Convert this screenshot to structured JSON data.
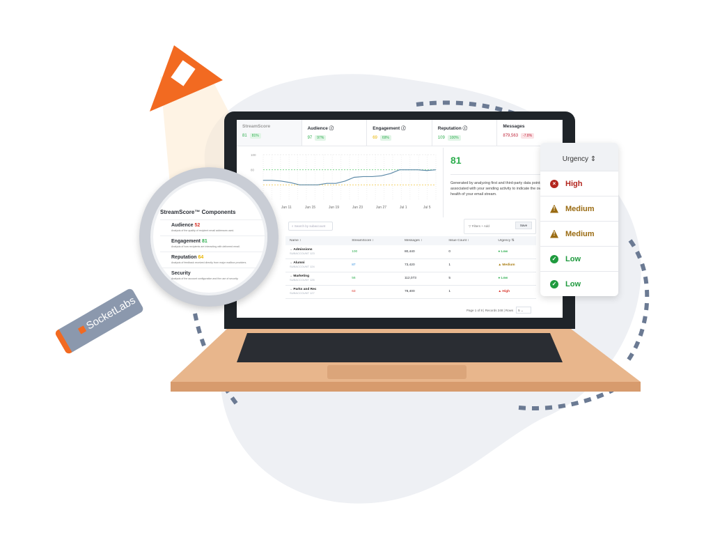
{
  "kpis": [
    {
      "label": "StreamScore",
      "value": "81",
      "pct": "81%"
    },
    {
      "label": "Audience ⓘ",
      "value": "97",
      "pct": "97%"
    },
    {
      "label": "Engagement ⓘ",
      "value": "69",
      "pct": "69%"
    },
    {
      "label": "Reputation ⓘ",
      "value": "109",
      "pct": "100%"
    },
    {
      "label": "Messages",
      "value": "879,563",
      "pct": "-7.8%"
    }
  ],
  "chart_data": {
    "type": "line",
    "x": [
      "Jun 11",
      "Jun 15",
      "Jun 19",
      "Jun 23",
      "Jun 27",
      "Jul 1",
      "Jul 5"
    ],
    "y_ticks": [
      "100",
      "80",
      "60"
    ],
    "ylim": [
      40,
      100
    ],
    "values": [
      66,
      66,
      65,
      63,
      60,
      60,
      60,
      62,
      62,
      65,
      70,
      71,
      71,
      72,
      75,
      80,
      80,
      80,
      79,
      80
    ],
    "thresholds": [
      80,
      60
    ]
  },
  "score": {
    "value": "81",
    "description": "Generated by analyzing first and third-party data points associated with your sending activity to indicate the overall health of your email stream."
  },
  "search": {
    "placeholder": "Search by subaccount"
  },
  "filters": {
    "label": "▽ Filters",
    "add": "+ Add",
    "save": "Save"
  },
  "table": {
    "headers": [
      "Name ↕",
      "StreamScore ↕",
      "Messages ↕",
      "Issue Count ↕",
      "Urgency ⇅"
    ],
    "rows": [
      {
        "name": "Admissions",
        "sub": "SUBACCOUNT 123",
        "score": "100",
        "sc": "g",
        "messages": "80,440",
        "issues": "0",
        "urgency": "● Low",
        "uc": "g"
      },
      {
        "name": "Alumni",
        "sub": "SUBACCOUNT 124",
        "score": "87",
        "sc": "b",
        "messages": "73,420",
        "issues": "1",
        "urgency": "▲ Medium",
        "uc": "m"
      },
      {
        "name": "Marketing",
        "sub": "SUBACCOUNT 126",
        "score": "56",
        "sc": "g",
        "messages": "112,073",
        "issues": "5",
        "urgency": "● Low",
        "uc": "g"
      },
      {
        "name": "Parks and Rec",
        "sub": "SUBACCOUNT 127",
        "score": "63",
        "sc": "r",
        "messages": "78,400",
        "issues": "1",
        "urgency": "▲ High",
        "uc": "r"
      }
    ]
  },
  "pager": {
    "text": "Page 1 of 8 | Records 248 | Rows",
    "rows": "5 ⌄"
  },
  "urgency_card": {
    "header": "Urgency ⇕",
    "items": [
      {
        "label": "High",
        "icon": "×",
        "color": "#b3261e"
      },
      {
        "label": "Medium",
        "icon": "!",
        "color": "#9a6b12"
      },
      {
        "label": "Medium",
        "icon": "!",
        "color": "#9a6b12"
      },
      {
        "label": "Low",
        "icon": "✓",
        "color": "#1f9a3e"
      },
      {
        "label": "Low",
        "icon": "✓",
        "color": "#1f9a3e"
      }
    ]
  },
  "components": {
    "title": "StreamScore™ Components",
    "items": [
      {
        "name": "Audience",
        "score": "52",
        "color": "#d9382e",
        "desc": "Analysis of the quality of recipient email addresses used."
      },
      {
        "name": "Engagement",
        "score": "81",
        "color": "#2eae4f",
        "desc": "Analysis of how recipients are interacting with delivered email."
      },
      {
        "name": "Reputation",
        "score": "64",
        "color": "#e8b400",
        "desc": "Analysis of feedback received directly from major mailbox providers."
      },
      {
        "name": "Security",
        "score": "",
        "color": "#d9382e",
        "desc": "Analysis of the account configuration and the use of security."
      }
    ]
  },
  "brand": "SocketLabs",
  "colors": {
    "accent": "#f26a21",
    "deck": "#e8b68c",
    "bezel": "#1f2429"
  }
}
